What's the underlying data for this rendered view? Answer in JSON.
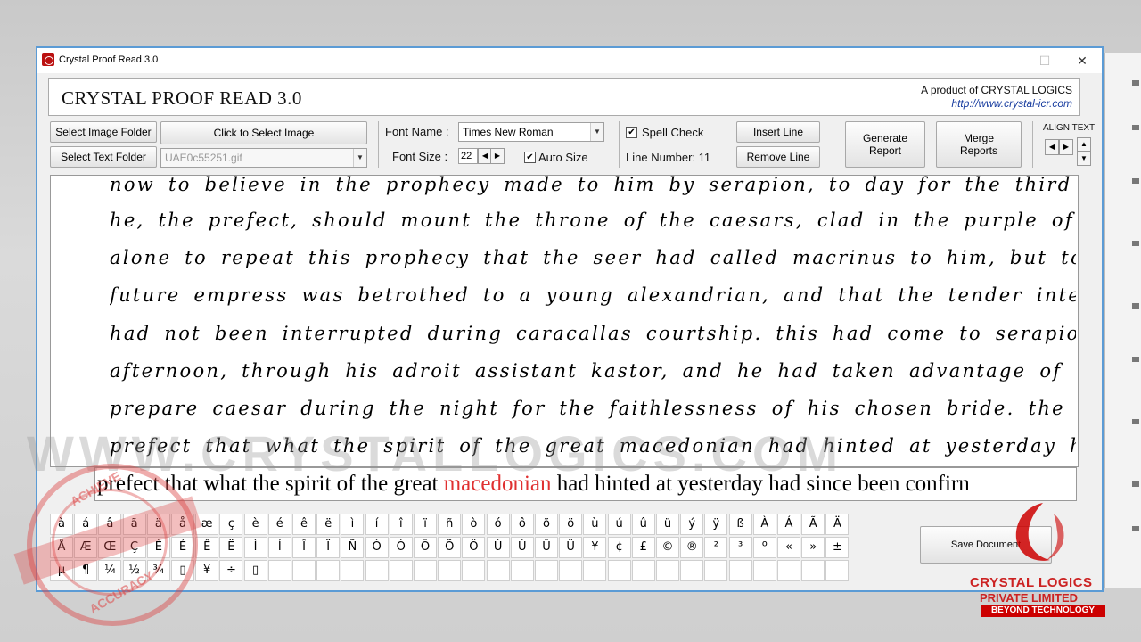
{
  "window": {
    "title": "Crystal Proof Read 3.0",
    "min": "—",
    "max": "☐",
    "close": "✕"
  },
  "header": {
    "title": "CRYSTAL PROOF READ 3.0",
    "product": "A product of CRYSTAL LOGICS",
    "url": "http://www.crystal-icr.com"
  },
  "toolbar": {
    "select_image_folder": "Select Image Folder",
    "select_text_folder": "Select Text Folder",
    "click_select_image": "Click to Select Image",
    "file_name": "UAE0c55251.gif",
    "font_name_label": "Font Name :",
    "font_name_value": "Times New Roman",
    "font_size_label": "Font Size :",
    "font_size_value": "22",
    "auto_size_label": "Auto Size",
    "spell_check_label": "Spell Check",
    "line_number_label": "Line Number: 11",
    "insert_line": "Insert Line",
    "remove_line": "Remove Line",
    "generate_report": "Generate Report",
    "merge_reports": "Merge Reports",
    "align_text": "ALIGN TEXT"
  },
  "handwriting_lines": [
    "now to believe in the prophecy made to him by serapion, to day for the third time, which foretold that",
    "he, the prefect, should mount the throne of the caesars, clad in the purple of caracalla. but it was not",
    "alone to repeat this prophecy that the seer had called macrinus to him, but to inform him that the",
    "future empress was betrothed to a young alexandrian, and that the tender intercourse between the lovers",
    "had not been interrupted during caracallas courtship. this had come to serapions ears yesterday",
    "afternoon, through his adroit assistant kastor, and he had taken advantage of the information to",
    "prepare caesar during the night for the faithlessness of his chosen bride. the magian assured the",
    "prefect that what the spirit of the great macedonian had hinted at yesterday had since been confirmed"
  ],
  "edit_line": {
    "before": "prefect that what the spirit of the great ",
    "highlight": "macedonian",
    "after": " had hinted at yesterday had since been confirn"
  },
  "char_rows": [
    [
      "à",
      "á",
      "â",
      "ã",
      "ä",
      "å",
      "æ",
      "ç",
      "è",
      "é",
      "ê",
      "ë",
      "ì",
      "í",
      "î",
      "ï",
      "ñ",
      "ò",
      "ó",
      "ô",
      "õ",
      "ö",
      "ù",
      "ú",
      "û",
      "ü",
      "ý",
      "ÿ",
      "ß",
      "À",
      "Á",
      "Ã",
      "Ä"
    ],
    [
      "Å",
      "Æ",
      "Œ",
      "Ç",
      "È",
      "É",
      "Ê",
      "Ë",
      "Ì",
      "Í",
      "Î",
      "Ï",
      "Ñ",
      "Ò",
      "Ó",
      "Ô",
      "Õ",
      "Ö",
      "Ù",
      "Ú",
      "Û",
      "Ü",
      "¥",
      "¢",
      "£",
      "©",
      "®",
      "²",
      "³",
      "º",
      "«",
      "»",
      "±"
    ],
    [
      "µ",
      "¶",
      "¼",
      "½",
      "¾",
      "▯",
      "¥",
      "÷",
      "▯",
      "",
      "",
      "",
      "",
      "",
      "",
      "",
      "",
      "",
      "",
      "",
      "",
      "",
      "",
      "",
      "",
      "",
      "",
      "",
      "",
      "",
      "",
      "",
      ""
    ]
  ],
  "save_document": "Save Document",
  "watermark": "WWW.CRYSTALLOGICS.COM",
  "seal": {
    "top": "ACHIEVE",
    "bottom": "ACCURACY"
  },
  "brand": {
    "name": "CRYSTAL LOGICS",
    "sub": "PRIVATE LIMITED",
    "tag": "BEYOND TECHNOLOGY"
  }
}
